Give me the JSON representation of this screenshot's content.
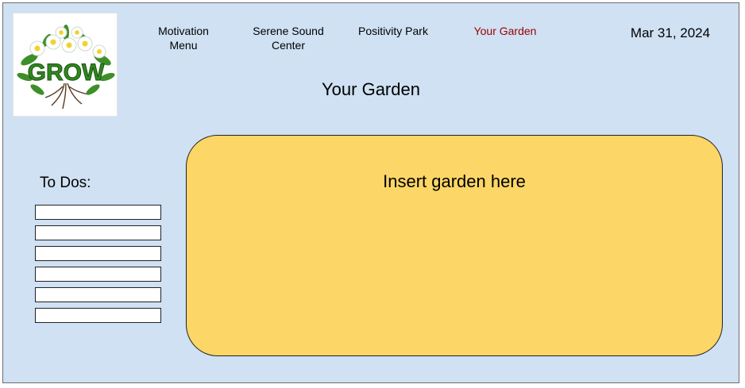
{
  "logo": {
    "text": "GROW",
    "icon": "flower-bouquet-icon"
  },
  "nav": {
    "items": [
      {
        "label": "Motivation\nMenu"
      },
      {
        "label": "Serene Sound\nCenter"
      },
      {
        "label": "Positivity Park"
      },
      {
        "label": "Your Garden"
      }
    ]
  },
  "header": {
    "date": "Mar 31, 2024",
    "page_title": "Your Garden"
  },
  "todos": {
    "heading": "To Dos:",
    "items": [
      "",
      "",
      "",
      "",
      "",
      ""
    ]
  },
  "garden": {
    "placeholder": "Insert garden here"
  },
  "colors": {
    "background": "#cfe1f3",
    "garden_fill": "#fcd666",
    "active_nav": "#990000",
    "logo_green": "#2f8a1f"
  }
}
